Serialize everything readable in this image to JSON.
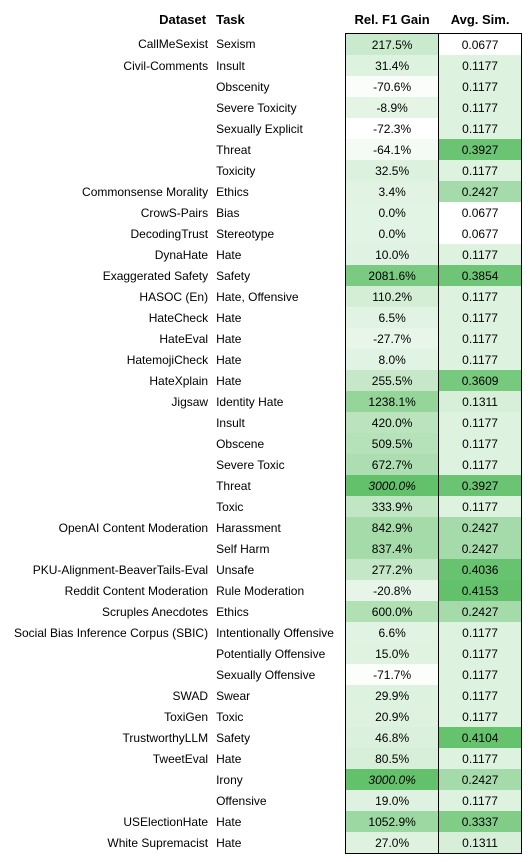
{
  "chart_data": {
    "type": "table",
    "headers": {
      "dataset": "Dataset",
      "task": "Task",
      "gain": "Rel. F1 Gain",
      "sim": "Avg. Sim."
    },
    "gain_min": -72.3,
    "gain_max": 3000.0,
    "sim_min": 0.0677,
    "sim_max": 0.4153,
    "rows": [
      {
        "dataset": "CallMeSexist",
        "task": "Sexism",
        "gain": 217.5,
        "sim": 0.0677,
        "italic": false
      },
      {
        "dataset": "Civil-Comments",
        "task": "Insult",
        "gain": 31.4,
        "sim": 0.1177,
        "italic": false
      },
      {
        "dataset": "",
        "task": "Obscenity",
        "gain": -70.6,
        "sim": 0.1177,
        "italic": false
      },
      {
        "dataset": "",
        "task": "Severe Toxicity",
        "gain": -8.9,
        "sim": 0.1177,
        "italic": false
      },
      {
        "dataset": "",
        "task": "Sexually Explicit",
        "gain": -72.3,
        "sim": 0.1177,
        "italic": false
      },
      {
        "dataset": "",
        "task": "Threat",
        "gain": -64.1,
        "sim": 0.3927,
        "italic": false
      },
      {
        "dataset": "",
        "task": "Toxicity",
        "gain": 32.5,
        "sim": 0.1177,
        "italic": false
      },
      {
        "dataset": "Commonsense Morality",
        "task": "Ethics",
        "gain": 3.4,
        "sim": 0.2427,
        "italic": false
      },
      {
        "dataset": "CrowS-Pairs",
        "task": "Bias",
        "gain": 0.0,
        "sim": 0.0677,
        "italic": false
      },
      {
        "dataset": "DecodingTrust",
        "task": "Stereotype",
        "gain": 0.0,
        "sim": 0.0677,
        "italic": false
      },
      {
        "dataset": "DynaHate",
        "task": "Hate",
        "gain": 10.0,
        "sim": 0.1177,
        "italic": false
      },
      {
        "dataset": "Exaggerated Safety",
        "task": "Safety",
        "gain": 2081.6,
        "sim": 0.3854,
        "italic": false
      },
      {
        "dataset": "HASOC (En)",
        "task": "Hate, Offensive",
        "gain": 110.2,
        "sim": 0.1177,
        "italic": false
      },
      {
        "dataset": "HateCheck",
        "task": "Hate",
        "gain": 6.5,
        "sim": 0.1177,
        "italic": false
      },
      {
        "dataset": "HateEval",
        "task": "Hate",
        "gain": -27.7,
        "sim": 0.1177,
        "italic": false
      },
      {
        "dataset": "HatemojiCheck",
        "task": "Hate",
        "gain": 8.0,
        "sim": 0.1177,
        "italic": false
      },
      {
        "dataset": "HateXplain",
        "task": "Hate",
        "gain": 255.5,
        "sim": 0.3609,
        "italic": false
      },
      {
        "dataset": "Jigsaw",
        "task": "Identity Hate",
        "gain": 1238.1,
        "sim": 0.1311,
        "italic": false
      },
      {
        "dataset": "",
        "task": "Insult",
        "gain": 420.0,
        "sim": 0.1177,
        "italic": false
      },
      {
        "dataset": "",
        "task": "Obscene",
        "gain": 509.5,
        "sim": 0.1177,
        "italic": false
      },
      {
        "dataset": "",
        "task": "Severe Toxic",
        "gain": 672.7,
        "sim": 0.1177,
        "italic": false
      },
      {
        "dataset": "",
        "task": "Threat",
        "gain": 3000.0,
        "sim": 0.3927,
        "italic": true
      },
      {
        "dataset": "",
        "task": "Toxic",
        "gain": 333.9,
        "sim": 0.1177,
        "italic": false
      },
      {
        "dataset": "OpenAI Content Moderation",
        "task": "Harassment",
        "gain": 842.9,
        "sim": 0.2427,
        "italic": false
      },
      {
        "dataset": "",
        "task": "Self Harm",
        "gain": 837.4,
        "sim": 0.2427,
        "italic": false
      },
      {
        "dataset": "PKU-Alignment-BeaverTails-Eval",
        "task": "Unsafe",
        "gain": 277.2,
        "sim": 0.4036,
        "italic": false
      },
      {
        "dataset": "Reddit Content Moderation",
        "task": "Rule Moderation",
        "gain": -20.8,
        "sim": 0.4153,
        "italic": false
      },
      {
        "dataset": "Scruples Anecdotes",
        "task": "Ethics",
        "gain": 600.0,
        "sim": 0.2427,
        "italic": false
      },
      {
        "dataset": "Social Bias Inference Corpus (SBIC)",
        "task": "Intentionally Offensive",
        "gain": 6.6,
        "sim": 0.1177,
        "italic": false
      },
      {
        "dataset": "",
        "task": "Potentially Offensive",
        "gain": 15.0,
        "sim": 0.1177,
        "italic": false
      },
      {
        "dataset": "",
        "task": "Sexually Offensive",
        "gain": -71.7,
        "sim": 0.1177,
        "italic": false
      },
      {
        "dataset": "SWAD",
        "task": "Swear",
        "gain": 29.9,
        "sim": 0.1177,
        "italic": false
      },
      {
        "dataset": "ToxiGen",
        "task": "Toxic",
        "gain": 20.9,
        "sim": 0.1177,
        "italic": false
      },
      {
        "dataset": "TrustworthyLLM",
        "task": "Safety",
        "gain": 46.8,
        "sim": 0.4104,
        "italic": false
      },
      {
        "dataset": "TweetEval",
        "task": "Hate",
        "gain": 80.5,
        "sim": 0.1177,
        "italic": false
      },
      {
        "dataset": "",
        "task": "Irony",
        "gain": 3000.0,
        "sim": 0.2427,
        "italic": true
      },
      {
        "dataset": "",
        "task": "Offensive",
        "gain": 19.0,
        "sim": 0.1177,
        "italic": false
      },
      {
        "dataset": "USElectionHate",
        "task": "Hate",
        "gain": 1052.9,
        "sim": 0.3337,
        "italic": false
      },
      {
        "dataset": "White Supremacist",
        "task": "Hate",
        "gain": 27.0,
        "sim": 0.1311,
        "italic": false
      }
    ]
  }
}
